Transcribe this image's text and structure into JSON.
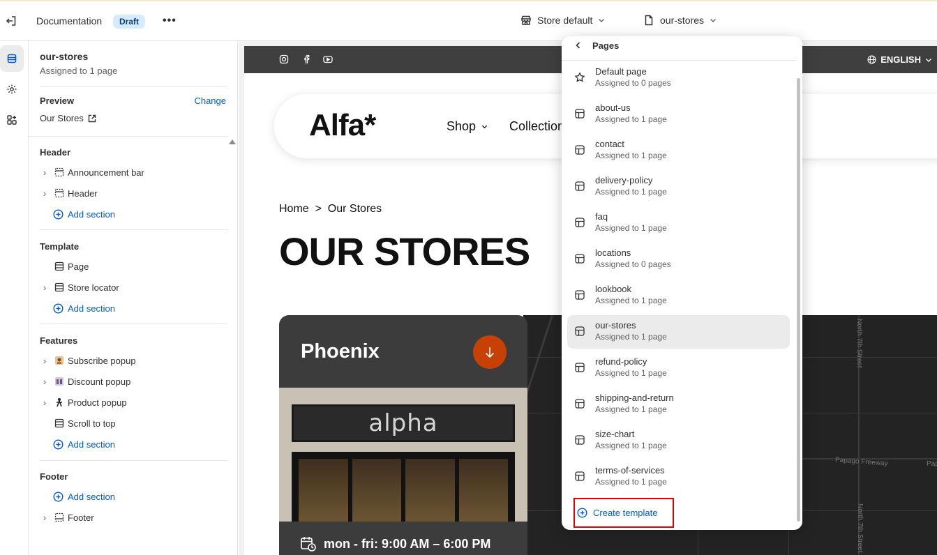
{
  "topbar": {
    "title": "Documentation",
    "badge": "Draft",
    "more": "•••",
    "store_selector": "Store default",
    "page_selector": "our-stores"
  },
  "sidebar": {
    "template_name": "our-stores",
    "assigned": "Assigned to 1 page",
    "preview_label": "Preview",
    "change_label": "Change",
    "preview_value": "Our Stores",
    "header": {
      "title": "Header",
      "items": [
        "Announcement bar",
        "Header"
      ],
      "add": "Add section"
    },
    "template": {
      "title": "Template",
      "items": [
        "Page",
        "Store locator"
      ],
      "add": "Add section"
    },
    "features": {
      "title": "Features",
      "items": [
        "Subscribe popup",
        "Discount popup",
        "Product popup",
        "Scroll to top"
      ],
      "add": "Add section"
    },
    "footer": {
      "title": "Footer",
      "add": "Add section",
      "items": [
        "Footer"
      ]
    }
  },
  "preview": {
    "language": "ENGLISH",
    "logo": "Alfa*",
    "nav": [
      "Shop",
      "Collection"
    ],
    "breadcrumb": "Home  >  Our Stores",
    "heading": "OUR STORES",
    "store_city": "Phoenix",
    "storefront_sign": "alpha",
    "hours": "mon - fri: 9:00 AM – 6:00 PM",
    "map_labels": [
      "Papago Freeway",
      "Papa",
      "North 7th Street",
      "North 7th Street"
    ]
  },
  "dropdown": {
    "title": "Pages",
    "items": [
      {
        "name": "Default page",
        "sub": "Assigned to 0 pages",
        "icon": "star-icon"
      },
      {
        "name": "about-us",
        "sub": "Assigned to 1 page",
        "icon": "layout-icon"
      },
      {
        "name": "contact",
        "sub": "Assigned to 1 page",
        "icon": "layout-icon"
      },
      {
        "name": "delivery-policy",
        "sub": "Assigned to 1 page",
        "icon": "layout-icon"
      },
      {
        "name": "faq",
        "sub": "Assigned to 1 page",
        "icon": "layout-icon"
      },
      {
        "name": "locations",
        "sub": "Assigned to 0 pages",
        "icon": "layout-icon"
      },
      {
        "name": "lookbook",
        "sub": "Assigned to 1 page",
        "icon": "layout-icon"
      },
      {
        "name": "our-stores",
        "sub": "Assigned to 1 page",
        "icon": "layout-icon",
        "selected": true
      },
      {
        "name": "refund-policy",
        "sub": "Assigned to 1 page",
        "icon": "layout-icon"
      },
      {
        "name": "shipping-and-return",
        "sub": "Assigned to 1 page",
        "icon": "layout-icon"
      },
      {
        "name": "size-chart",
        "sub": "Assigned to 1 page",
        "icon": "layout-icon"
      },
      {
        "name": "terms-of-services",
        "sub": "Assigned to 1 page",
        "icon": "layout-icon"
      }
    ],
    "create": "Create template"
  },
  "colors": {
    "link": "#005bd3",
    "badge_bg": "#d5ebff",
    "highlight_box": "#e40000",
    "card_button": "#c84104"
  }
}
